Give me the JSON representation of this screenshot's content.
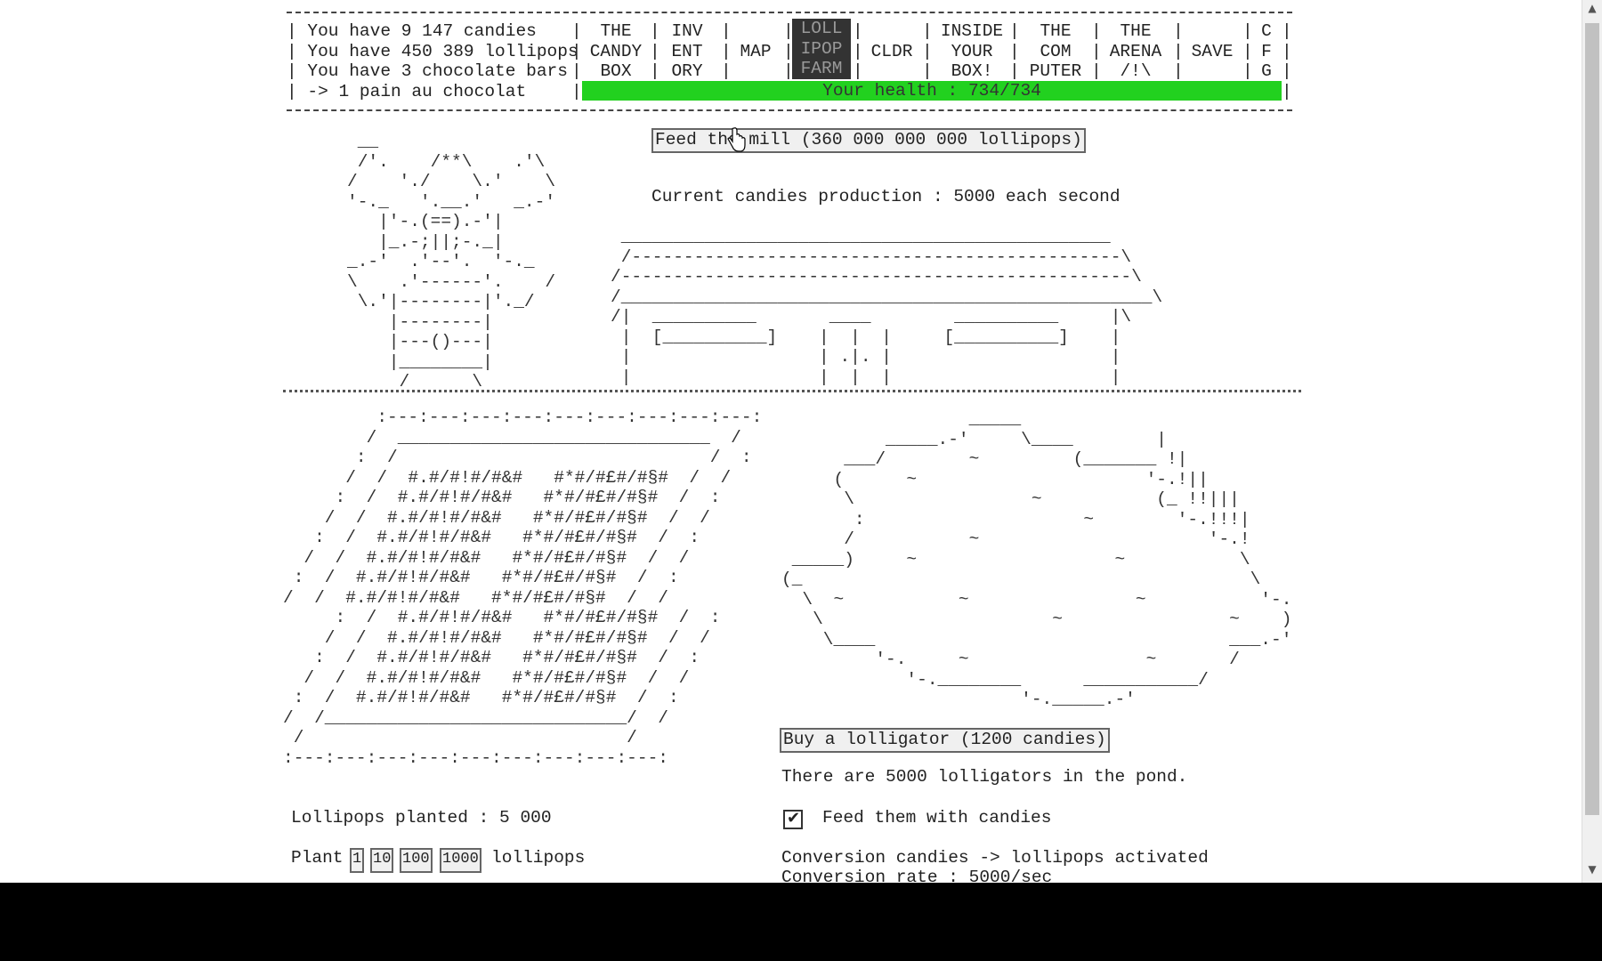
{
  "resources": {
    "candies": "| You have 9 147 candies",
    "lollipops": "| You have 450 389 lollipops",
    "chocolate": "| You have 3 chocolate bars",
    "pain": "| -> 1 pain au chocolat"
  },
  "menu": [
    {
      "l1": "THE",
      "l2": "CANDY",
      "l3": "BOX"
    },
    {
      "l1": "INV",
      "l2": " ENT",
      "l3": "ORY"
    },
    {
      "l1": "",
      "l2": "MAP",
      "l3": ""
    },
    {
      "l1": "LOLL",
      "l2": "IPOP",
      "l3": "FARM"
    },
    {
      "l1": "",
      "l2": "CLDR",
      "l3": ""
    },
    {
      "l1": "INSIDE",
      "l2": "YOUR",
      "l3": "BOX!"
    },
    {
      "l1": "THE",
      "l2": "COM",
      "l3": "PUTER"
    },
    {
      "l1": "THE",
      "l2": "ARENA",
      "l3": "/!\\"
    },
    {
      "l1": "",
      "l2": "SAVE",
      "l3": ""
    },
    {
      "l1": "C",
      "l2": "F",
      "l3": "G"
    }
  ],
  "health": {
    "text": "Your health : 734/734",
    "fraction": 1.0,
    "color": "#22d11f"
  },
  "mill": {
    "feed_button": "Feed the mill (360 000 000 000 lollipops)",
    "production": "Current candies production : 5000 each second"
  },
  "field": {
    "planted": "Lollipops planted : 5 000",
    "plant_label": "Plant",
    "plant_options": [
      "1",
      "10",
      "100",
      "1000"
    ],
    "plant_suffix": "lollipops"
  },
  "pond": {
    "buy_button": "Buy a lolligator (1200 candies)",
    "count_text": "There are 5000 lolligators in the pond.",
    "feed_checkbox_label": "Feed them with candies",
    "feed_checked": true,
    "conversion_text": "Conversion candies -> lollipops activated",
    "rate_text": "Conversion rate : 5000/sec"
  },
  "art": {
    "mill": " __\n /'.    /**\\    .'\\\n/    './    \\.'    \\\n'-._   '.__.'   _.-'\n   |'-.(==).-'|\n   |_.-;||;-._|\n_.-'  .'--'.  '-._\n\\    .'------'.    /\n \\.'|--------|'._/\n    |--------|\n    |---()---|\n    |________|\n     /      \\",
    "farm": " _______________________________________________\n /-----------------------------------------------\\\n/-------------------------------------------------\\\n/___________________________________________________\\\n/|  __________       ____        __________     |\\\n |  [__________]    |  |  |     [__________]    |\n |                  | .|. |                     |\n |                  |  |  |                     |",
    "field": "       :---:---:---:---:---:---:---:---:---:\n      /  ___________________________   /\n     :  /                            /  :\n    /  /  #.#/#!#/#&#   #*#/#£#/#§#  /  /\n   :  /  #.#/#!#/#&#   #*#/#£#/#§#  /  :\n  /  /  #.#/#!#/#&#   #*#/#£#/#§#  /  /\n :  /  #.#/#!#/#&#   #*#/#£#/#§#  /  :\n/  /  #.#/#!#/#&#   #*#/#£#/#§#  /  /\n",
    "pond": "                  _____\n          _____.-'     \\____        |\n      ___/        ~         (_______ !|\n     (      ~                      '-.!||\n      \\                 ~           (_ !!|||\n       :                     ~        '-.!!!|\n      /           ~                      '-.!\n _____)     ~                   ~           \\\n(_                                           \\\n  \\  ~           ~                ~           '-.\n   \\                      ~                ~    )\n    \\____                                  ___.-'\n         '-.     ~                 ~       /\n            '-.________      ___________/\n                       '-._____.-'"
  }
}
